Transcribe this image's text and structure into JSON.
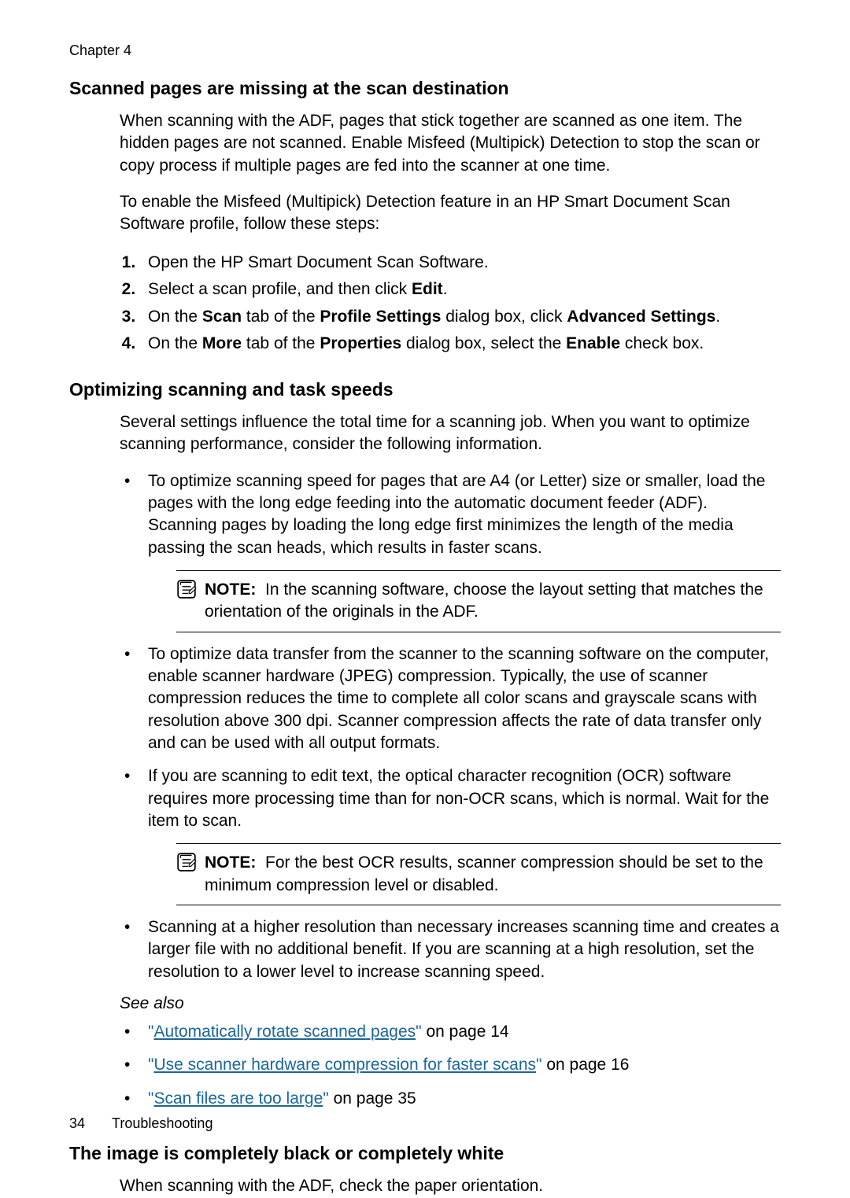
{
  "chapter": "Chapter 4",
  "section1": {
    "title": "Scanned pages are missing at the scan destination",
    "p1": "When scanning with the ADF, pages that stick together are scanned as one item. The hidden pages are not scanned. Enable Misfeed (Multipick) Detection to stop the scan or copy process if multiple pages are fed into the scanner at one time.",
    "p2": "To enable the Misfeed (Multipick) Detection feature in an HP Smart Document Scan Software profile, follow these steps:",
    "steps": {
      "s1": "Open the HP Smart Document Scan Software.",
      "s2a": "Select a scan profile, and then click ",
      "s2b": "Edit",
      "s2c": ".",
      "s3a": "On the ",
      "s3b": "Scan",
      "s3c": " tab of the ",
      "s3d": "Profile Settings",
      "s3e": " dialog box, click ",
      "s3f": "Advanced Settings",
      "s3g": ".",
      "s4a": "On the ",
      "s4b": "More",
      "s4c": " tab of the ",
      "s4d": "Properties",
      "s4e": " dialog box, select the ",
      "s4f": "Enable",
      "s4g": " check box."
    }
  },
  "section2": {
    "title": "Optimizing scanning and task speeds",
    "p1": "Several settings influence the total time for a scanning job. When you want to optimize scanning performance, consider the following information.",
    "b1": "To optimize scanning speed for pages that are A4 (or Letter) size or smaller, load the pages with the long edge feeding into the automatic document feeder (ADF). Scanning pages by loading the long edge first minimizes the length of the media passing the scan heads, which results in faster scans.",
    "note1_label": "NOTE:",
    "note1_text": "In the scanning software, choose the layout setting that matches the orientation of the originals in the ADF.",
    "b2": "To optimize data transfer from the scanner to the scanning software on the computer, enable scanner hardware (JPEG) compression. Typically, the use of scanner compression reduces the time to complete all color scans and grayscale scans with resolution above 300 dpi. Scanner compression affects the rate of data transfer only and can be used with all output formats.",
    "b3": "If you are scanning to edit text, the optical character recognition (OCR) software requires more processing time than for non-OCR scans, which is normal. Wait for the item to scan.",
    "note2_label": "NOTE:",
    "note2_text": "For the best OCR results, scanner compression should be set to the minimum compression level or disabled.",
    "b4": "Scanning at a higher resolution than necessary increases scanning time and creates a larger file with no additional benefit. If you are scanning at a high resolution, set the resolution to a lower level to increase scanning speed.",
    "see_also": "See also",
    "links": {
      "l1q1": "\"",
      "l1": "Automatically rotate scanned pages",
      "l1q2": "\"",
      "l1t": " on page 14",
      "l2q1": "\"",
      "l2": "Use scanner hardware compression for faster scans",
      "l2q2": "\"",
      "l2t": " on page 16",
      "l3q1": "\"",
      "l3": "Scan files are too large",
      "l3q2": "\"",
      "l3t": " on page 35"
    }
  },
  "section3": {
    "title": "The image is completely black or completely white",
    "p1": "When scanning with the ADF, check the paper orientation."
  },
  "footer": {
    "page": "34",
    "title": "Troubleshooting"
  }
}
